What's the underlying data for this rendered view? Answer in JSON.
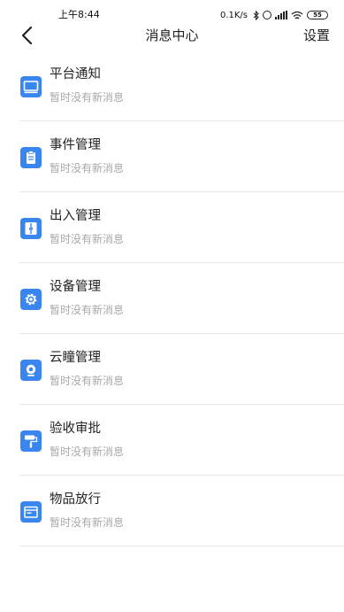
{
  "status_bar": {
    "time": "上午8:44",
    "net_speed": "0.1K/s",
    "battery": "55"
  },
  "nav": {
    "title": "消息中心",
    "settings_label": "设置",
    "back_icon": "chevron-left-icon"
  },
  "messages": [
    {
      "title": "平台通知",
      "subtitle": "暂时没有新消息",
      "icon": "monitor-icon"
    },
    {
      "title": "事件管理",
      "subtitle": "暂时没有新消息",
      "icon": "clipboard-icon"
    },
    {
      "title": "出入管理",
      "subtitle": "暂时没有新消息",
      "icon": "door-icon"
    },
    {
      "title": "设备管理",
      "subtitle": "暂时没有新消息",
      "icon": "gear-icon"
    },
    {
      "title": "云瞳管理",
      "subtitle": "暂时没有新消息",
      "icon": "camera-icon"
    },
    {
      "title": "验收审批",
      "subtitle": "暂时没有新消息",
      "icon": "paint-roller-icon"
    },
    {
      "title": "物品放行",
      "subtitle": "暂时没有新消息",
      "icon": "package-icon"
    }
  ],
  "colors": {
    "icon_accent": "#3a86f0",
    "divider": "#e6e6e6",
    "subtitle": "#a8a8a8"
  }
}
